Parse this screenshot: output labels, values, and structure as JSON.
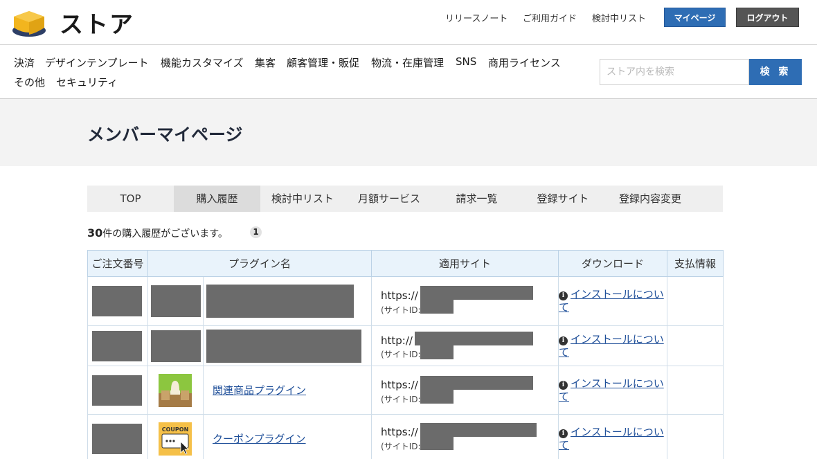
{
  "header": {
    "logo_text": "ストア",
    "links": [
      "リリースノート",
      "ご利用ガイド",
      "検討中リスト"
    ],
    "mypage_button": "マイページ",
    "logout_button": "ログアウト"
  },
  "categories": [
    "決済",
    "デザインテンプレート",
    "機能カスタマイズ",
    "集客",
    "顧客管理・販促",
    "物流・在庫管理",
    "SNS",
    "商用ライセンス",
    "その他",
    "セキュリティ"
  ],
  "search": {
    "placeholder": "ストア内を検索",
    "button": "検 索"
  },
  "page_title": "メンバーマイページ",
  "tabs": [
    "TOP",
    "購入履歴",
    "検討中リスト",
    "月額サービス",
    "請求一覧",
    "登録サイト",
    "登録内容変更"
  ],
  "active_tab": "購入履歴",
  "count": {
    "number": "30",
    "text": "件の購入履歴がございます。",
    "page": "1"
  },
  "table": {
    "headers": [
      "ご注文番号",
      "プラグイン名",
      "適用サイト",
      "ダウンロード",
      "支払情報"
    ],
    "rows": [
      {
        "plugin_name": "",
        "site_url": "https://",
        "site_id": "(サイトID:",
        "download_label": "インストールについて"
      },
      {
        "plugin_name": "",
        "site_url": "http://",
        "site_id": "(サイトID:",
        "download_label": "インストールについて"
      },
      {
        "plugin_name": "関連商品プラグイン",
        "site_url": "https://",
        "site_id": "(サイトID:",
        "download_label": "インストールについて"
      },
      {
        "plugin_name": "クーポンプラグイン",
        "site_url": "https://",
        "site_id": "(サイトID:",
        "download_label": "インストールについて"
      }
    ]
  },
  "icons": {
    "logo": "store-box-icon",
    "info": "info-icon",
    "related_product_thumb": "related-product-thumbnail",
    "coupon_thumb": "coupon-thumbnail",
    "coupon_thumb_text": "COUPON"
  },
  "colors": {
    "primary": "#2e6db4",
    "logout": "#555555",
    "table_header": "#e9f3fb",
    "link": "#1f4f99"
  }
}
